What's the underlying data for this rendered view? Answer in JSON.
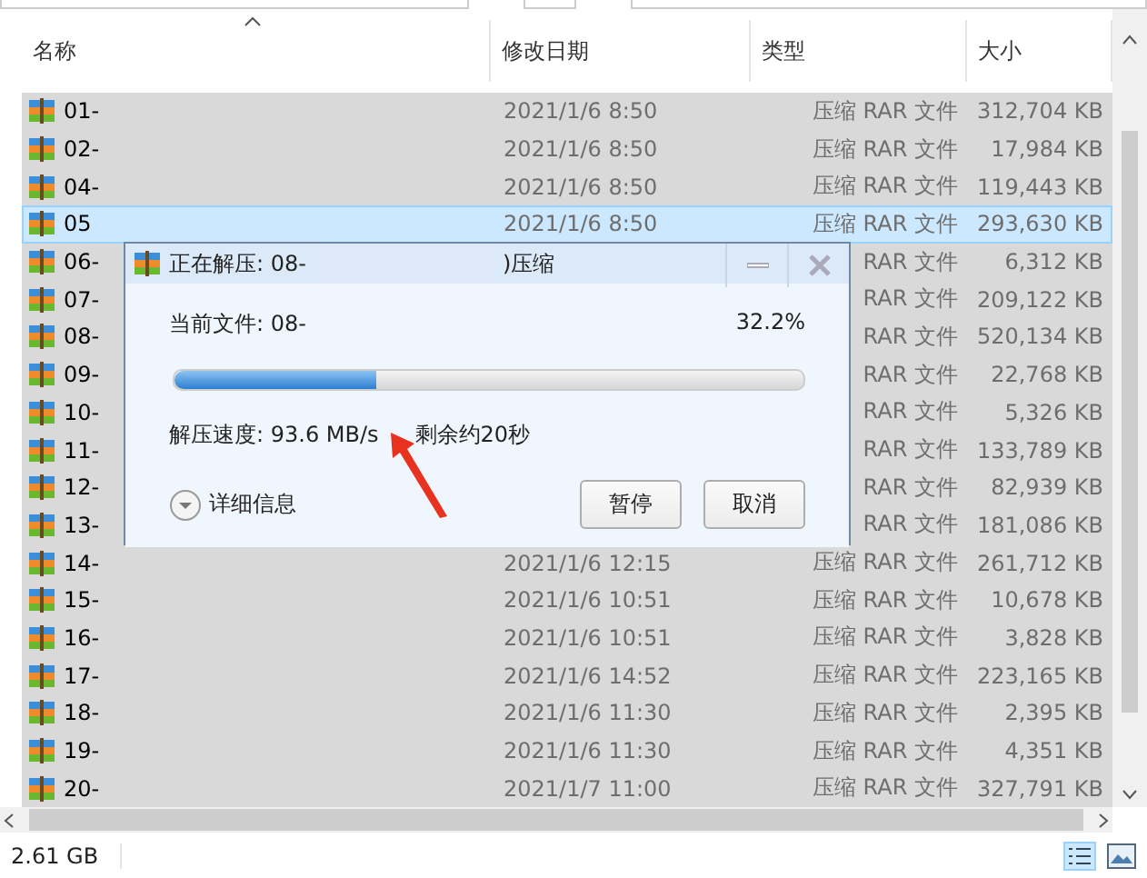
{
  "columns": [
    {
      "label": "名称",
      "sorted": true
    },
    {
      "label": "修改日期",
      "sorted": false
    },
    {
      "label": "类型",
      "sorted": false
    },
    {
      "label": "大小",
      "sorted": false
    }
  ],
  "rows": [
    {
      "name": "01-",
      "date": "2021/1/6 8:50",
      "type": "压缩 RAR 文件",
      "size": "312,704 KB",
      "selected": false
    },
    {
      "name": "02-",
      "date": "2021/1/6 8:50",
      "type": "压缩 RAR 文件",
      "size": "17,984 KB",
      "selected": false
    },
    {
      "name": "04-",
      "date": "2021/1/6 8:50",
      "type": "压缩 RAR 文件",
      "size": "119,443 KB",
      "selected": false
    },
    {
      "name": "05",
      "date": "2021/1/6 8:50",
      "type": "压缩 RAR 文件",
      "size": "293,630 KB",
      "selected": true
    },
    {
      "name": "06-",
      "type": "RAR 文件",
      "size": "6,312 KB",
      "selected": false
    },
    {
      "name": "07-",
      "type": "RAR 文件",
      "size": "209,122 KB",
      "selected": false
    },
    {
      "name": "08-",
      "type": "RAR 文件",
      "size": "520,134 KB",
      "selected": false
    },
    {
      "name": "09-",
      "type": "RAR 文件",
      "size": "22,768 KB",
      "selected": false
    },
    {
      "name": "10-",
      "type": "RAR 文件",
      "size": "5,326 KB",
      "selected": false
    },
    {
      "name": "11-",
      "type": "RAR 文件",
      "size": "133,789 KB",
      "selected": false
    },
    {
      "name": "12-",
      "type": "RAR 文件",
      "size": "82,939 KB",
      "selected": false
    },
    {
      "name": "13-",
      "type": "RAR 文件",
      "size": "181,086 KB",
      "selected": false
    },
    {
      "name": "14-",
      "date": "2021/1/6 12:15",
      "type": "压缩 RAR 文件",
      "size": "261,712 KB",
      "selected": false
    },
    {
      "name": "15-",
      "date": "2021/1/6 10:51",
      "type": "压缩 RAR 文件",
      "size": "10,678 KB",
      "selected": false
    },
    {
      "name": "16-",
      "date": "2021/1/6 10:51",
      "type": "压缩 RAR 文件",
      "size": "3,828 KB",
      "selected": false
    },
    {
      "name": "17-",
      "date": "2021/1/6 14:52",
      "type": "压缩 RAR 文件",
      "size": "223,165 KB",
      "selected": false
    },
    {
      "name": "18-",
      "date": "2021/1/6 11:30",
      "type": "压缩 RAR 文件",
      "size": "2,395 KB",
      "selected": false
    },
    {
      "name": "19-",
      "date": "2021/1/6 11:30",
      "type": "压缩 RAR 文件",
      "size": "4,351 KB",
      "selected": false
    },
    {
      "name": "20-",
      "date": "2021/1/7 11:00",
      "type": "压缩 RAR 文件",
      "size": "327,791 KB",
      "selected": false
    }
  ],
  "dialog": {
    "title_start": "正在解压: 08-",
    "title_end": ")压缩",
    "current_file": "当前文件: 08-",
    "percent": "32.2%",
    "level": 0.322,
    "speed": "解压速度: 93.6 MB/s",
    "remaining": "剩余约20秒",
    "details": "详细信息",
    "buttons": [
      "暂停",
      "取消"
    ]
  },
  "status_bar": {
    "size": "2.61 GB"
  }
}
